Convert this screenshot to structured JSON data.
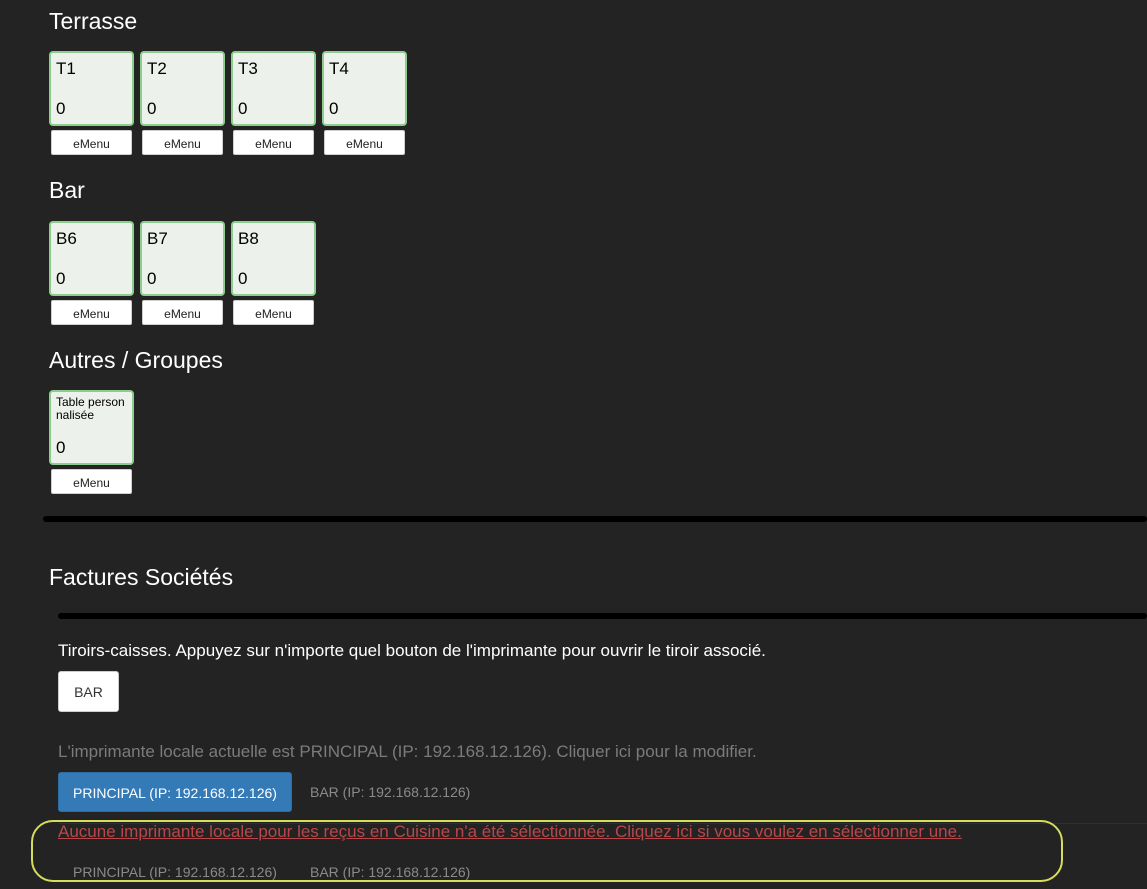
{
  "sections": [
    {
      "title": "Terrasse",
      "tables": [
        {
          "name": "T1",
          "count": "0",
          "emenu": "eMenu"
        },
        {
          "name": "T2",
          "count": "0",
          "emenu": "eMenu"
        },
        {
          "name": "T3",
          "count": "0",
          "emenu": "eMenu"
        },
        {
          "name": "T4",
          "count": "0",
          "emenu": "eMenu"
        }
      ]
    },
    {
      "title": "Bar",
      "tables": [
        {
          "name": "B6",
          "count": "0",
          "emenu": "eMenu"
        },
        {
          "name": "B7",
          "count": "0",
          "emenu": "eMenu"
        },
        {
          "name": "B8",
          "count": "0",
          "emenu": "eMenu"
        }
      ]
    },
    {
      "title": "Autres / Groupes",
      "tables": [
        {
          "name": "Table personnalisée",
          "count": "0",
          "emenu": "eMenu"
        }
      ]
    }
  ],
  "factures": {
    "title": "Factures Sociétés"
  },
  "drawers": {
    "text": "Tiroirs-caisses. Appuyez sur n'importe quel bouton de l'imprimante pour ouvrir le tiroir associé.",
    "button": "BAR"
  },
  "local_printer": {
    "text": "L'imprimante locale actuelle est PRINCIPAL (IP: 192.168.12.126). Cliquer ici pour la modifier.",
    "options": [
      "PRINCIPAL (IP: 192.168.12.126)",
      "BAR (IP: 192.168.12.126)"
    ],
    "selected": "PRINCIPAL (IP: 192.168.12.126)"
  },
  "kitchen_printer": {
    "warning": "Aucune imprimante locale pour les reçus en Cuisine n'a été sélectionnée. Cliquez ici si vous voulez en sélectionner une.",
    "options": [
      "PRINCIPAL (IP: 192.168.12.126)",
      "BAR (IP: 192.168.12.126)"
    ]
  },
  "colors": {
    "background": "#232323",
    "tile_background": "#ecf1eb",
    "tile_border": "#8ccc8c",
    "primary_button": "#337ab7",
    "muted_text": "#7b7b7b",
    "warning_text": "#b9474a",
    "annotation_outline": "#d6dc5c"
  }
}
